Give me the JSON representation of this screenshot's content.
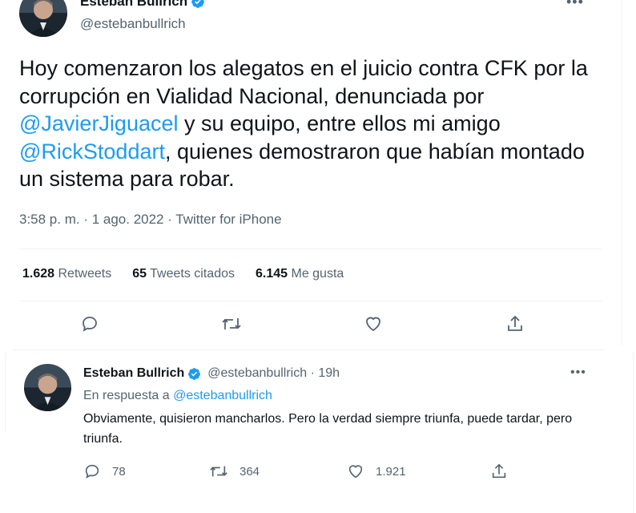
{
  "main_tweet": {
    "author_name": "Esteban Bullrich",
    "author_handle": "@estebanbullrich",
    "text_parts": {
      "p1": "Hoy comenzaron los alegatos en el juicio contra CFK por la corrupción en Vialidad Nacional, denunciada por ",
      "mention1": "@JavierJiguacel",
      "p2": " y su equipo, entre ellos mi amigo ",
      "mention2": "@RickStoddart",
      "p3": ", quienes demostraron que habían montado un sistema para robar."
    },
    "meta": "3:58 p. m. · 1 ago. 2022 · Twitter for iPhone",
    "stats": {
      "retweets_count": "1.628",
      "retweets_label": "Retweets",
      "quotes_count": "65",
      "quotes_label": "Tweets citados",
      "likes_count": "6.145",
      "likes_label": "Me gusta"
    },
    "more_label": "•••"
  },
  "reply_tweet": {
    "author_name": "Esteban Bullrich",
    "author_handle_time": "@estebanbullrich · 19h",
    "reply_to_prefix": "En respuesta a ",
    "reply_to_handle": "@estebanbullrich",
    "text": "Obviamente, quisieron mancharlos. Pero la verdad siempre triunfa, puede tardar, pero triunfa.",
    "replies": "78",
    "retweets": "364",
    "likes": "1.921",
    "more_label": "•••"
  },
  "colors": {
    "accent": "#1d9bf0",
    "text": "#0f1419",
    "secondary": "#536471",
    "divider": "#eff3f4"
  },
  "icons": [
    "verified-badge-icon",
    "reply-icon",
    "retweet-icon",
    "like-icon",
    "share-icon",
    "more-icon"
  ]
}
